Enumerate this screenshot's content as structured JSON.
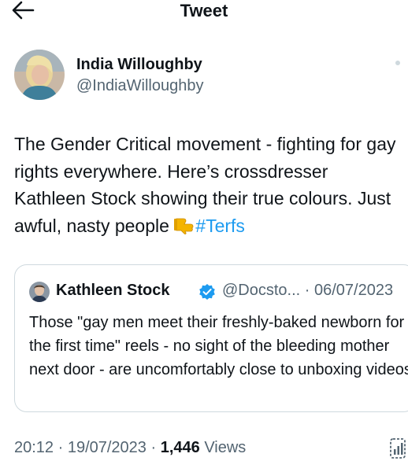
{
  "header": {
    "title": "Tweet",
    "back_icon": "arrow-left-icon"
  },
  "author": {
    "name": "India Willoughby",
    "handle": "@IndiaWilloughby"
  },
  "tweet": {
    "text": "The Gender Critical movement - fighting for gay rights everywhere. Here’s crossdresser Kathleen Stock showing their true colours. Just awful, nasty people ",
    "emoji": "thumbs-down-icon",
    "hashtag": "#Terfs"
  },
  "quote": {
    "name": "Kathleen Stock",
    "verified_icon": "verified-badge-icon",
    "meta": "@Docsto... · 06/07/2023",
    "text": "Those \"gay men meet their freshly-baked newborn for the first time\" reels - no sight of the bleeding mother next door - are uncomfortably close to unboxing videos"
  },
  "footer": {
    "timestamp": "20:12 · 19/07/2023 · ",
    "views_count": "1,446",
    "views_label": " Views"
  },
  "colors": {
    "accent": "#1d9bf0",
    "secondary_text": "#536471",
    "border": "#cfd9de",
    "verified": "#1d9bf0",
    "emoji": "#f4b400"
  }
}
